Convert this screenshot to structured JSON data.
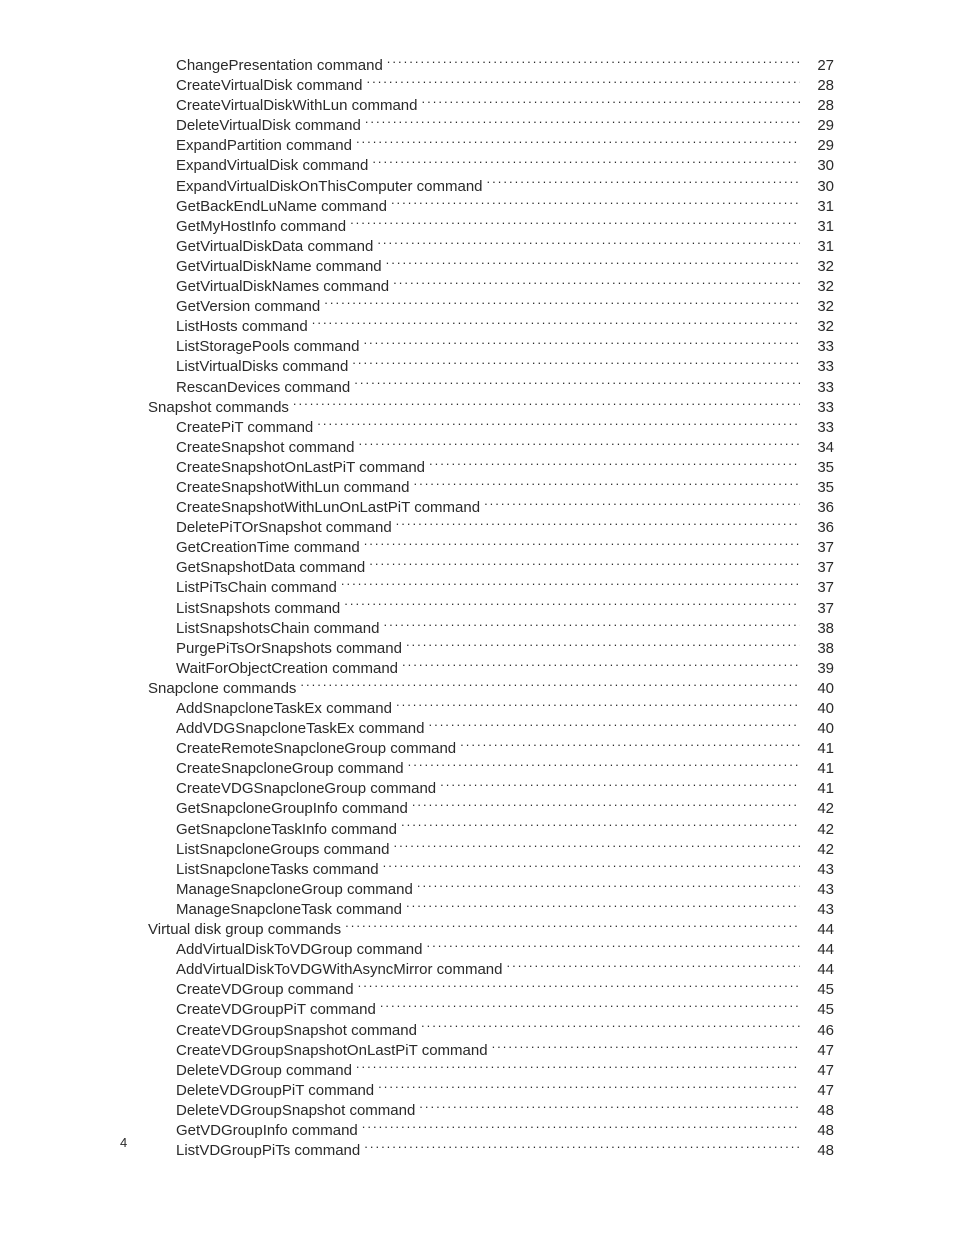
{
  "page_number": "4",
  "toc": [
    {
      "level": 2,
      "title": "ChangePresentation command",
      "page": "27"
    },
    {
      "level": 2,
      "title": "CreateVirtualDisk command",
      "page": "28"
    },
    {
      "level": 2,
      "title": "CreateVirtualDiskWithLun command",
      "page": "28"
    },
    {
      "level": 2,
      "title": "DeleteVirtualDisk command",
      "page": "29"
    },
    {
      "level": 2,
      "title": "ExpandPartition command",
      "page": "29"
    },
    {
      "level": 2,
      "title": "ExpandVirtualDisk command",
      "page": "30"
    },
    {
      "level": 2,
      "title": "ExpandVirtualDiskOnThisComputer command",
      "page": "30"
    },
    {
      "level": 2,
      "title": "GetBackEndLuName command",
      "page": "31"
    },
    {
      "level": 2,
      "title": "GetMyHostInfo command",
      "page": "31"
    },
    {
      "level": 2,
      "title": "GetVirtualDiskData command",
      "page": "31"
    },
    {
      "level": 2,
      "title": "GetVirtualDiskName command",
      "page": "32"
    },
    {
      "level": 2,
      "title": "GetVirtualDiskNames command",
      "page": "32"
    },
    {
      "level": 2,
      "title": "GetVersion command",
      "page": "32"
    },
    {
      "level": 2,
      "title": "ListHosts command",
      "page": "32"
    },
    {
      "level": 2,
      "title": "ListStoragePools command",
      "page": "33"
    },
    {
      "level": 2,
      "title": "ListVirtualDisks command",
      "page": "33"
    },
    {
      "level": 2,
      "title": "RescanDevices command",
      "page": "33"
    },
    {
      "level": 1,
      "title": "Snapshot commands",
      "page": "33"
    },
    {
      "level": 2,
      "title": "CreatePiT command",
      "page": "33"
    },
    {
      "level": 2,
      "title": "CreateSnapshot command",
      "page": "34"
    },
    {
      "level": 2,
      "title": "CreateSnapshotOnLastPiT command",
      "page": "35"
    },
    {
      "level": 2,
      "title": "CreateSnapshotWithLun command",
      "page": "35"
    },
    {
      "level": 2,
      "title": "CreateSnapshotWithLunOnLastPiT command",
      "page": "36"
    },
    {
      "level": 2,
      "title": "DeletePiTOrSnapshot command",
      "page": "36"
    },
    {
      "level": 2,
      "title": "GetCreationTime command",
      "page": "37"
    },
    {
      "level": 2,
      "title": "GetSnapshotData command",
      "page": "37"
    },
    {
      "level": 2,
      "title": "ListPiTsChain command",
      "page": "37"
    },
    {
      "level": 2,
      "title": "ListSnapshots command",
      "page": "37"
    },
    {
      "level": 2,
      "title": "ListSnapshotsChain command",
      "page": "38"
    },
    {
      "level": 2,
      "title": "PurgePiTsOrSnapshots command",
      "page": "38"
    },
    {
      "level": 2,
      "title": "WaitForObjectCreation command",
      "page": "39"
    },
    {
      "level": 1,
      "title": "Snapclone commands",
      "page": "40"
    },
    {
      "level": 2,
      "title": "AddSnapcloneTaskEx command",
      "page": "40"
    },
    {
      "level": 2,
      "title": "AddVDGSnapcloneTaskEx command",
      "page": "40"
    },
    {
      "level": 2,
      "title": "CreateRemoteSnapcloneGroup command",
      "page": "41"
    },
    {
      "level": 2,
      "title": "CreateSnapcloneGroup command",
      "page": "41"
    },
    {
      "level": 2,
      "title": "CreateVDGSnapcloneGroup command",
      "page": "41"
    },
    {
      "level": 2,
      "title": "GetSnapcloneGroupInfo command",
      "page": "42"
    },
    {
      "level": 2,
      "title": "GetSnapcloneTaskInfo command",
      "page": "42"
    },
    {
      "level": 2,
      "title": "ListSnapcloneGroups command",
      "page": "42"
    },
    {
      "level": 2,
      "title": "ListSnapcloneTasks command",
      "page": "43"
    },
    {
      "level": 2,
      "title": "ManageSnapcloneGroup command",
      "page": "43"
    },
    {
      "level": 2,
      "title": "ManageSnapcloneTask command",
      "page": "43"
    },
    {
      "level": 1,
      "title": "Virtual disk group commands",
      "page": "44"
    },
    {
      "level": 2,
      "title": "AddVirtualDiskToVDGroup command",
      "page": "44"
    },
    {
      "level": 2,
      "title": "AddVirtualDiskToVDGWithAsyncMirror command",
      "page": "44"
    },
    {
      "level": 2,
      "title": "CreateVDGroup command",
      "page": "45"
    },
    {
      "level": 2,
      "title": "CreateVDGroupPiT command",
      "page": "45"
    },
    {
      "level": 2,
      "title": "CreateVDGroupSnapshot command",
      "page": "46"
    },
    {
      "level": 2,
      "title": "CreateVDGroupSnapshotOnLastPiT command",
      "page": "47"
    },
    {
      "level": 2,
      "title": "DeleteVDGroup command",
      "page": "47"
    },
    {
      "level": 2,
      "title": "DeleteVDGroupPiT command",
      "page": "47"
    },
    {
      "level": 2,
      "title": "DeleteVDGroupSnapshot command",
      "page": "48"
    },
    {
      "level": 2,
      "title": "GetVDGroupInfo command",
      "page": "48"
    },
    {
      "level": 2,
      "title": "ListVDGroupPiTs command",
      "page": "48"
    }
  ]
}
